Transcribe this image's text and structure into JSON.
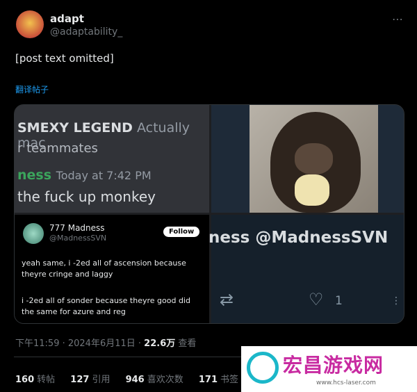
{
  "author": {
    "name": "adapt",
    "handle": "@adaptability_"
  },
  "post": {
    "text": "[post text omitted]",
    "translate_label": "翻译帖子"
  },
  "media": {
    "discord": {
      "line1_name": "SMEXY LEGEND",
      "line1_rest": "Actually mac",
      "line2": "r teammates",
      "line3_name": "ness",
      "line3_time": "Today at 7:42 PM",
      "line4": "the fuck up monkey"
    },
    "embedded_tweet": {
      "name": "777 Madness",
      "handle": "@MadnessSVN",
      "follow_label": "Follow",
      "para1": "yeah same, i -2ed all of ascension because theyre cringe and laggy",
      "para2": "i -2ed all of sonder because theyre good did the same for azure and reg"
    },
    "crop": {
      "handle_big": "ness @MadnessSVN",
      "like_count": "1"
    }
  },
  "meta": {
    "time": "下午11:59 · 2024年6月11日 ·",
    "views": "22.6万",
    "views_label": "查看"
  },
  "stats": [
    {
      "count": "160",
      "label": "转帖"
    },
    {
      "count": "127",
      "label": "引用"
    },
    {
      "count": "946",
      "label": "喜欢次数"
    },
    {
      "count": "171",
      "label": "书签"
    }
  ],
  "watermark": {
    "title": "宏昌游戏网",
    "url": "www.hcs-laser.com"
  }
}
